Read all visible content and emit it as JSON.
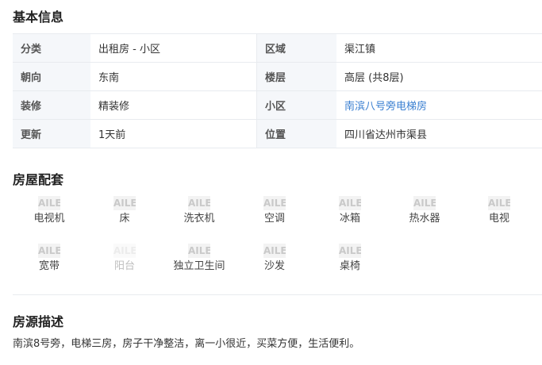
{
  "basic": {
    "title": "基本信息",
    "rows": [
      {
        "l1": "分类",
        "v1": "出租房 - 小区",
        "l2": "区域",
        "v2": "渠江镇"
      },
      {
        "l1": "朝向",
        "v1": "东南",
        "l2": "楼层",
        "v2": "高层 (共8层)"
      },
      {
        "l1": "装修",
        "v1": "精装修",
        "l2": "小区",
        "v2": "南滨八号旁电梯房"
      },
      {
        "l1": "更新",
        "v1": "1天前",
        "l2": "位置",
        "v2": "四川省达州市渠县"
      }
    ]
  },
  "facilities": {
    "title": "房屋配套",
    "icon_text": "AILE",
    "items": [
      {
        "icon_text": "AILE",
        "label": "电视机",
        "available": true
      },
      {
        "icon_text": "AILE",
        "label": "床",
        "available": true
      },
      {
        "icon_text": "AILE",
        "label": "洗衣机",
        "available": true
      },
      {
        "icon_text": "AILE",
        "label": "空调",
        "available": true
      },
      {
        "icon_text": "AILE",
        "label": "冰箱",
        "available": true
      },
      {
        "icon_text": "AILE",
        "label": "热水器",
        "available": true
      },
      {
        "icon_text": "AILE",
        "label": "电视",
        "available": true
      },
      {
        "icon_text": "AILE",
        "label": "宽带",
        "available": true
      },
      {
        "icon_text": "AILE",
        "label": "阳台",
        "available": false
      },
      {
        "icon_text": "AILE",
        "label": "独立卫生间",
        "available": true
      },
      {
        "icon_text": "AILE",
        "label": "沙发",
        "available": true
      },
      {
        "icon_text": "AILE",
        "label": "桌椅",
        "available": true
      }
    ]
  },
  "description": {
    "title": "房源描述",
    "text": "南滨8号旁，电梯三房，房子干净整洁，离一小很近，买菜方便，生活便利。"
  },
  "colors": {
    "link": "#3a7fd1",
    "label_bg": "#f5f7fa",
    "border": "#e8ebef"
  }
}
